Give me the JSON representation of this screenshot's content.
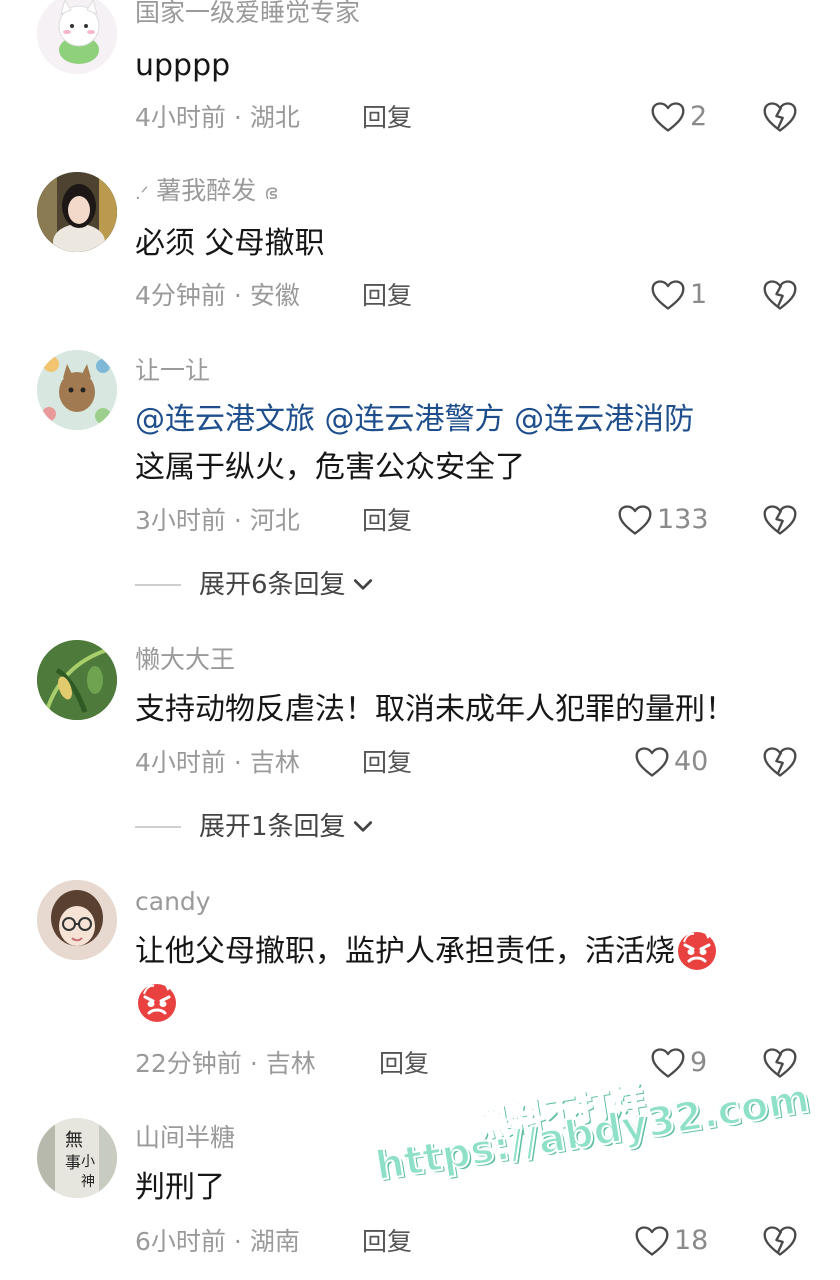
{
  "comments": [
    {
      "username": "国家一级爱睡觉专家",
      "lines": [
        "upppp"
      ],
      "time": "4小时前",
      "location": "湖北",
      "reply_label": "回复",
      "likes": "2"
    },
    {
      "username": "薯我醉发",
      "username_decor": ".ᐟ",
      "username_suffix": "ഭ",
      "lines": [
        "必须 父母撤职"
      ],
      "time": "4分钟前",
      "location": "安徽",
      "reply_label": "回复",
      "likes": "1"
    },
    {
      "username": "让一让",
      "mentions": [
        "@连云港文旅",
        "@连云港警方",
        "@连云港消防"
      ],
      "lines": [
        "这属于纵火，危害公众安全了"
      ],
      "time": "3小时前",
      "location": "河北",
      "reply_label": "回复",
      "likes": "133",
      "expand_label": "展开6条回复"
    },
    {
      "username": "懒大大王",
      "lines": [
        "支持动物反虐法！取消未成年人犯罪的量刑！"
      ],
      "time": "4小时前",
      "location": "吉林",
      "reply_label": "回复",
      "likes": "40",
      "expand_label": "展开1条回复"
    },
    {
      "username": "candy",
      "lines": [
        "让他父母撤职，监护人承担责任，活活烧"
      ],
      "emoji": "angry-face",
      "time": "22分钟前",
      "location": "吉林",
      "reply_label": "回复",
      "likes": "9"
    },
    {
      "username": "山间半糖",
      "lines": [
        "判刑了"
      ],
      "time": "6小时前",
      "location": "湖南",
      "reply_label": "回复",
      "likes": "18"
    }
  ],
  "watermark": {
    "line1": "黑料不打烊",
    "line2": "https://abdy32.com"
  },
  "colors": {
    "mention": "#1e4e8c",
    "muted": "#9a9a9a",
    "watermark": "#8ee0c8",
    "angry_emoji": "#e8413f"
  },
  "icons": {
    "like": "heart-outline-icon",
    "dislike": "broken-heart-icon",
    "expand": "chevron-down-icon"
  }
}
